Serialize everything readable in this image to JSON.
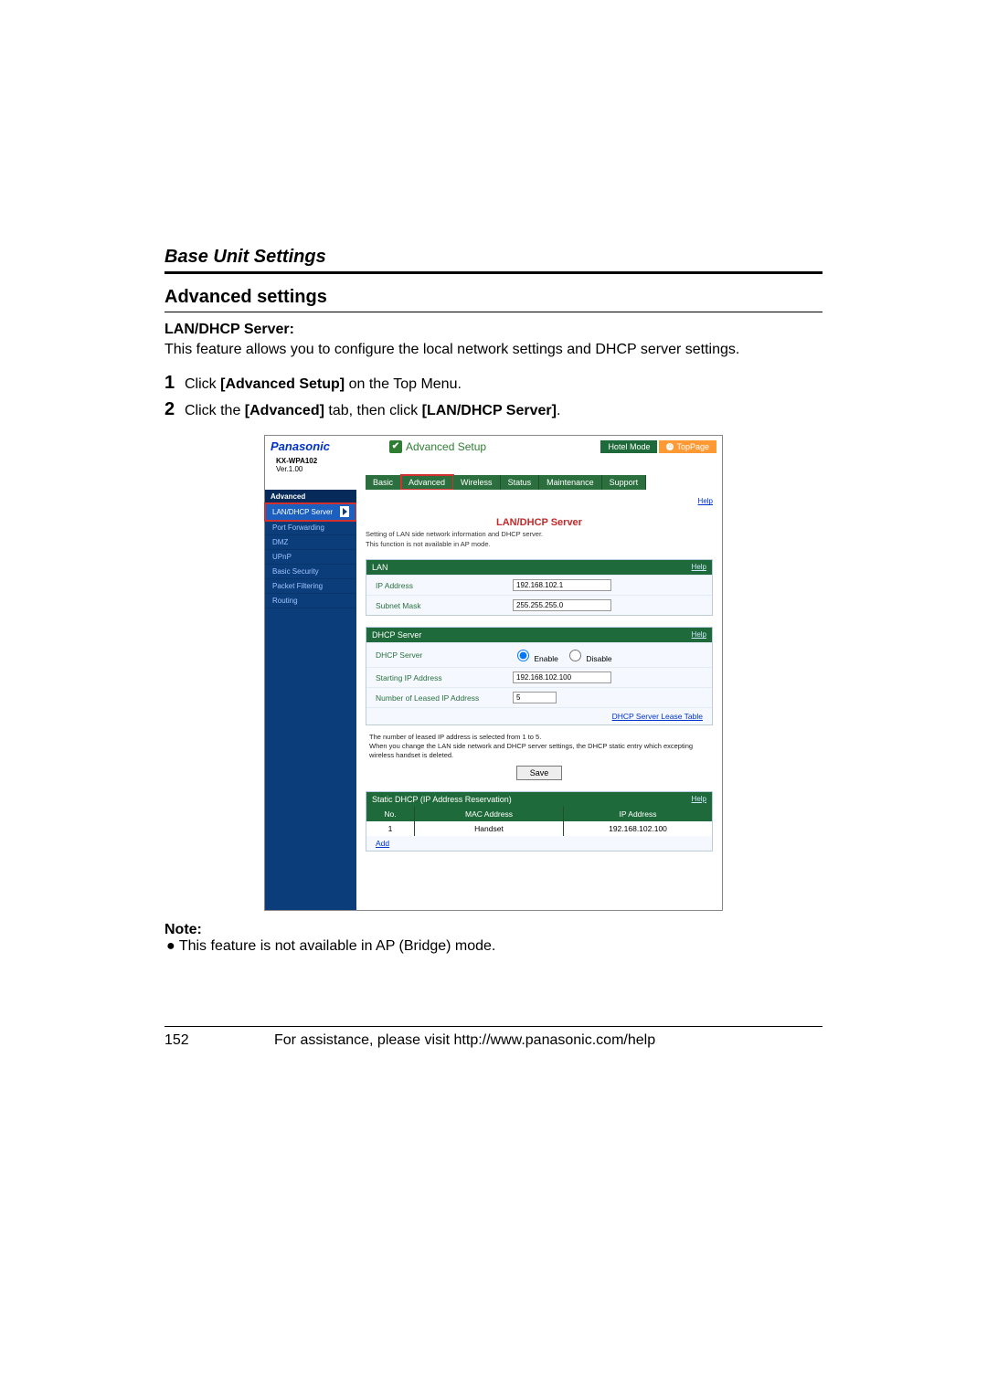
{
  "doc": {
    "section_title": "Base Unit Settings",
    "subsection": "Advanced settings",
    "lan_label": "LAN/DHCP Server:",
    "lan_desc": "This feature allows you to configure the local network settings and DHCP server settings.",
    "step1_num": "1",
    "step1_a": "Click ",
    "step1_b": "[Advanced Setup]",
    "step1_c": " on the Top Menu.",
    "step2_num": "2",
    "step2_a": "Click the ",
    "step2_b": "[Advanced]",
    "step2_c": " tab, then click ",
    "step2_d": "[LAN/DHCP Server]",
    "step2_e": ".",
    "note_label": "Note:",
    "note_bullet": "● This feature is not available in AP (Bridge) mode.",
    "page_num": "152",
    "footer_text": "For assistance, please visit http://www.panasonic.com/help"
  },
  "fig": {
    "brand": "Panasonic",
    "adv_setup": "Advanced Setup",
    "hotel": "Hotel Mode",
    "toppage": "TopPage",
    "model": "KX-WPA102",
    "ver": "Ver.1.00",
    "tabs": [
      "Basic",
      "Advanced",
      "Wireless",
      "Status",
      "Maintenance",
      "Support"
    ],
    "side_group": "Advanced",
    "side_items": [
      "LAN/DHCP Server",
      "Port Forwarding",
      "DMZ",
      "UPnP",
      "Basic Security",
      "Packet Filtering",
      "Routing"
    ],
    "title": "LAN/DHCP Server",
    "help": "Help",
    "desc1": "Setting of LAN side network information and DHCP server.",
    "desc2": "This function is not available in AP mode.",
    "panel_lan": "LAN",
    "ip_label": "IP Address",
    "ip_val": "192.168.102.1",
    "sub_label": "Subnet Mask",
    "sub_val": "255.255.255.0",
    "panel_dhcp": "DHCP Server",
    "dhcp_srv_label": "DHCP Server",
    "enable": "Enable",
    "disable": "Disable",
    "start_label": "Starting IP Address",
    "start_val": "192.168.102.100",
    "num_label": "Number of Leased IP Address",
    "num_val": "5",
    "lease_link": "DHCP Server Lease Table",
    "small1": "The number of leased IP address is selected from 1 to 5.",
    "small2": "When you change the LAN side network and DHCP server settings, the DHCP static entry which excepting wireless handset is deleted.",
    "save": "Save",
    "panel_static": "Static DHCP (IP Address Reservation)",
    "th_no": "No.",
    "th_mac": "MAC Address",
    "th_ip": "IP Address",
    "row_no": "1",
    "row_mac": "Handset",
    "row_ip": "192.168.102.100",
    "add": "Add"
  }
}
